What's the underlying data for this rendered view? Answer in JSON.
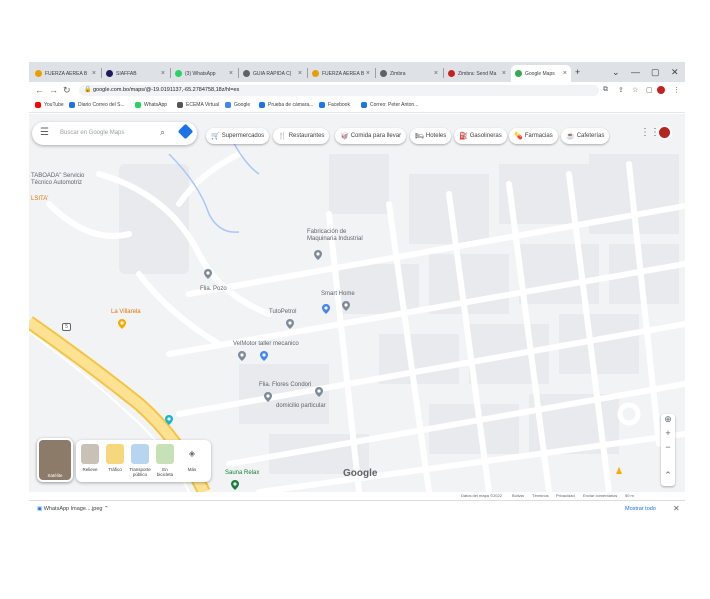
{
  "tabs": [
    {
      "label": "FUERZA AEREA B",
      "color": "#e8a000"
    },
    {
      "label": "SIAFFAB",
      "color": "#1a1a5e"
    },
    {
      "label": "(3) WhatsApp",
      "color": "#25d366"
    },
    {
      "label": "GUIA RAPIDA C(",
      "color": "#5f6368"
    },
    {
      "label": "FUERZA AEREA B",
      "color": "#e8a000"
    },
    {
      "label": "Zimbra",
      "color": "#5f6368"
    },
    {
      "label": "Zimbra: Send Ma",
      "color": "#c5221f"
    },
    {
      "label": "Google Maps",
      "color": "#34a853",
      "active": true
    }
  ],
  "window": {
    "minimize": "—",
    "maximize": "▢",
    "close": "✕",
    "new_tab": "+",
    "dropdown": "⌄"
  },
  "address": {
    "url": "google.com.bo/maps/@-19.0191137,-65.2784758,18z/hl=es"
  },
  "bookmarks": [
    {
      "label": "YouTube",
      "color": "#ff0000"
    },
    {
      "label": "Diario Correo del S...",
      "color": "#1a73e8"
    },
    {
      "label": "WhatsApp",
      "color": "#25d366"
    },
    {
      "label": "ECEMA Virtual",
      "color": "#555"
    },
    {
      "label": "Google",
      "color": "#4285f4"
    },
    {
      "label": "Prueba de cámara...",
      "color": "#1a73e8"
    },
    {
      "label": "Facebook",
      "color": "#1877f2"
    },
    {
      "label": "Correo: Peter Anton...",
      "color": "#1a73e8"
    }
  ],
  "search": {
    "placeholder": "Buscar en Google Maps"
  },
  "chips": [
    {
      "label": "Supermercados",
      "icon": "cart-icon",
      "glyph": "🛒"
    },
    {
      "label": "Restaurantes",
      "icon": "fork-knife-icon",
      "glyph": "🍴"
    },
    {
      "label": "Comida para llevar",
      "icon": "takeout-icon",
      "glyph": "🥡"
    },
    {
      "label": "Hoteles",
      "icon": "bed-icon",
      "glyph": "🛏"
    },
    {
      "label": "Gasolineras",
      "icon": "fuel-icon",
      "glyph": "⛽"
    },
    {
      "label": "Farmacias",
      "icon": "pill-icon",
      "glyph": "💊"
    },
    {
      "label": "Cafeterías",
      "icon": "coffee-icon",
      "glyph": "☕"
    }
  ],
  "places": [
    {
      "label": "TABOADA\" Servicio\nTécnico Automotriz",
      "color": "#5f6368"
    },
    {
      "label": "LSITA'",
      "color": "#e37400"
    },
    {
      "label": "Fabricación de\nMaquinaria Industrial",
      "color": "#5f6368"
    },
    {
      "label": "Flia. Pozo",
      "color": "#5f6368"
    },
    {
      "label": "Smart Home",
      "color": "#5f6368"
    },
    {
      "label": "La Villarela",
      "color": "#e37400"
    },
    {
      "label": "TutoPetrol",
      "color": "#5f6368"
    },
    {
      "label": "VelMotor taller mecanico",
      "color": "#5f6368"
    },
    {
      "label": "Flia. Flores Condori",
      "color": "#5f6368"
    },
    {
      "label": "domicilio particular",
      "color": "#5f6368"
    },
    {
      "label": "Sauna Relax",
      "color": "#188038"
    }
  ],
  "layers": {
    "main": "Satélite",
    "items": [
      "Relieve",
      "Tráfico",
      "Transporte\npúblico",
      "En\nbicicleta",
      "Más"
    ]
  },
  "map_logo": "Google",
  "route_badge": "5",
  "attribution": [
    "Datos del mapa ©2022",
    "Bolivia",
    "Términos",
    "Privacidad",
    "Enviar comentarios",
    "50 m"
  ],
  "download": {
    "item": "WhatsApp Image....jpeg",
    "show_all": "Mostrar todo",
    "close": "✕"
  }
}
